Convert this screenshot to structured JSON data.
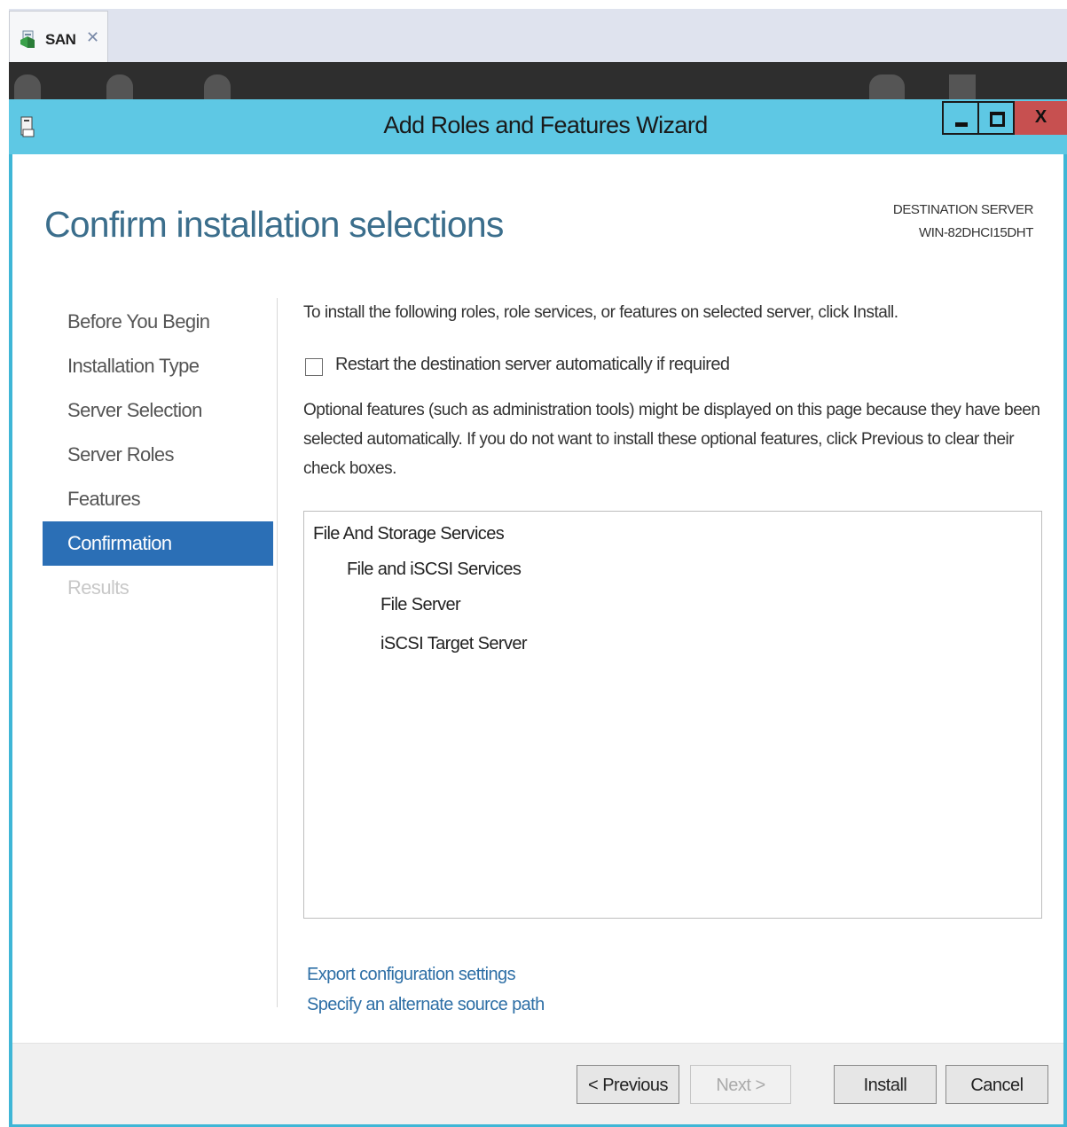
{
  "browser_tab": {
    "label": "SAN"
  },
  "window": {
    "title": "Add Roles and Features Wizard",
    "close_glyph": "X"
  },
  "header": {
    "page_title": "Confirm installation selections",
    "destination_label": "DESTINATION SERVER",
    "destination_server": "WIN-82DHCI15DHT"
  },
  "nav": {
    "items": [
      {
        "label": "Before You Begin",
        "state": "normal"
      },
      {
        "label": "Installation Type",
        "state": "normal"
      },
      {
        "label": "Server Selection",
        "state": "normal"
      },
      {
        "label": "Server Roles",
        "state": "normal"
      },
      {
        "label": "Features",
        "state": "normal"
      },
      {
        "label": "Confirmation",
        "state": "active"
      },
      {
        "label": "Results",
        "state": "disabled"
      }
    ]
  },
  "content": {
    "instruction": "To install the following roles, role services, or features on selected server, click Install.",
    "restart_checkbox": {
      "label": "Restart the destination server automatically if required",
      "checked": false
    },
    "optional_note": "Optional features (such as administration tools) might be displayed on this page because they have been selected automatically. If you do not want to install these optional features, click Previous to clear their check boxes.",
    "selections": [
      {
        "label": "File And Storage Services",
        "level": 0
      },
      {
        "label": "File and iSCSI Services",
        "level": 1
      },
      {
        "label": "File Server",
        "level": 2
      },
      {
        "label": "iSCSI Target Server",
        "level": 2
      }
    ],
    "links": {
      "export": "Export configuration settings",
      "alternate_source": "Specify an alternate source path"
    }
  },
  "footer": {
    "previous": "< Previous",
    "next": "Next >",
    "install": "Install",
    "cancel": "Cancel"
  },
  "colors": {
    "title_bar": "#5ec8e4",
    "accent_blue": "#2b6fb6",
    "title_text": "#3b6e8c",
    "link": "#2e6fa6",
    "close_button": "#c75050"
  }
}
